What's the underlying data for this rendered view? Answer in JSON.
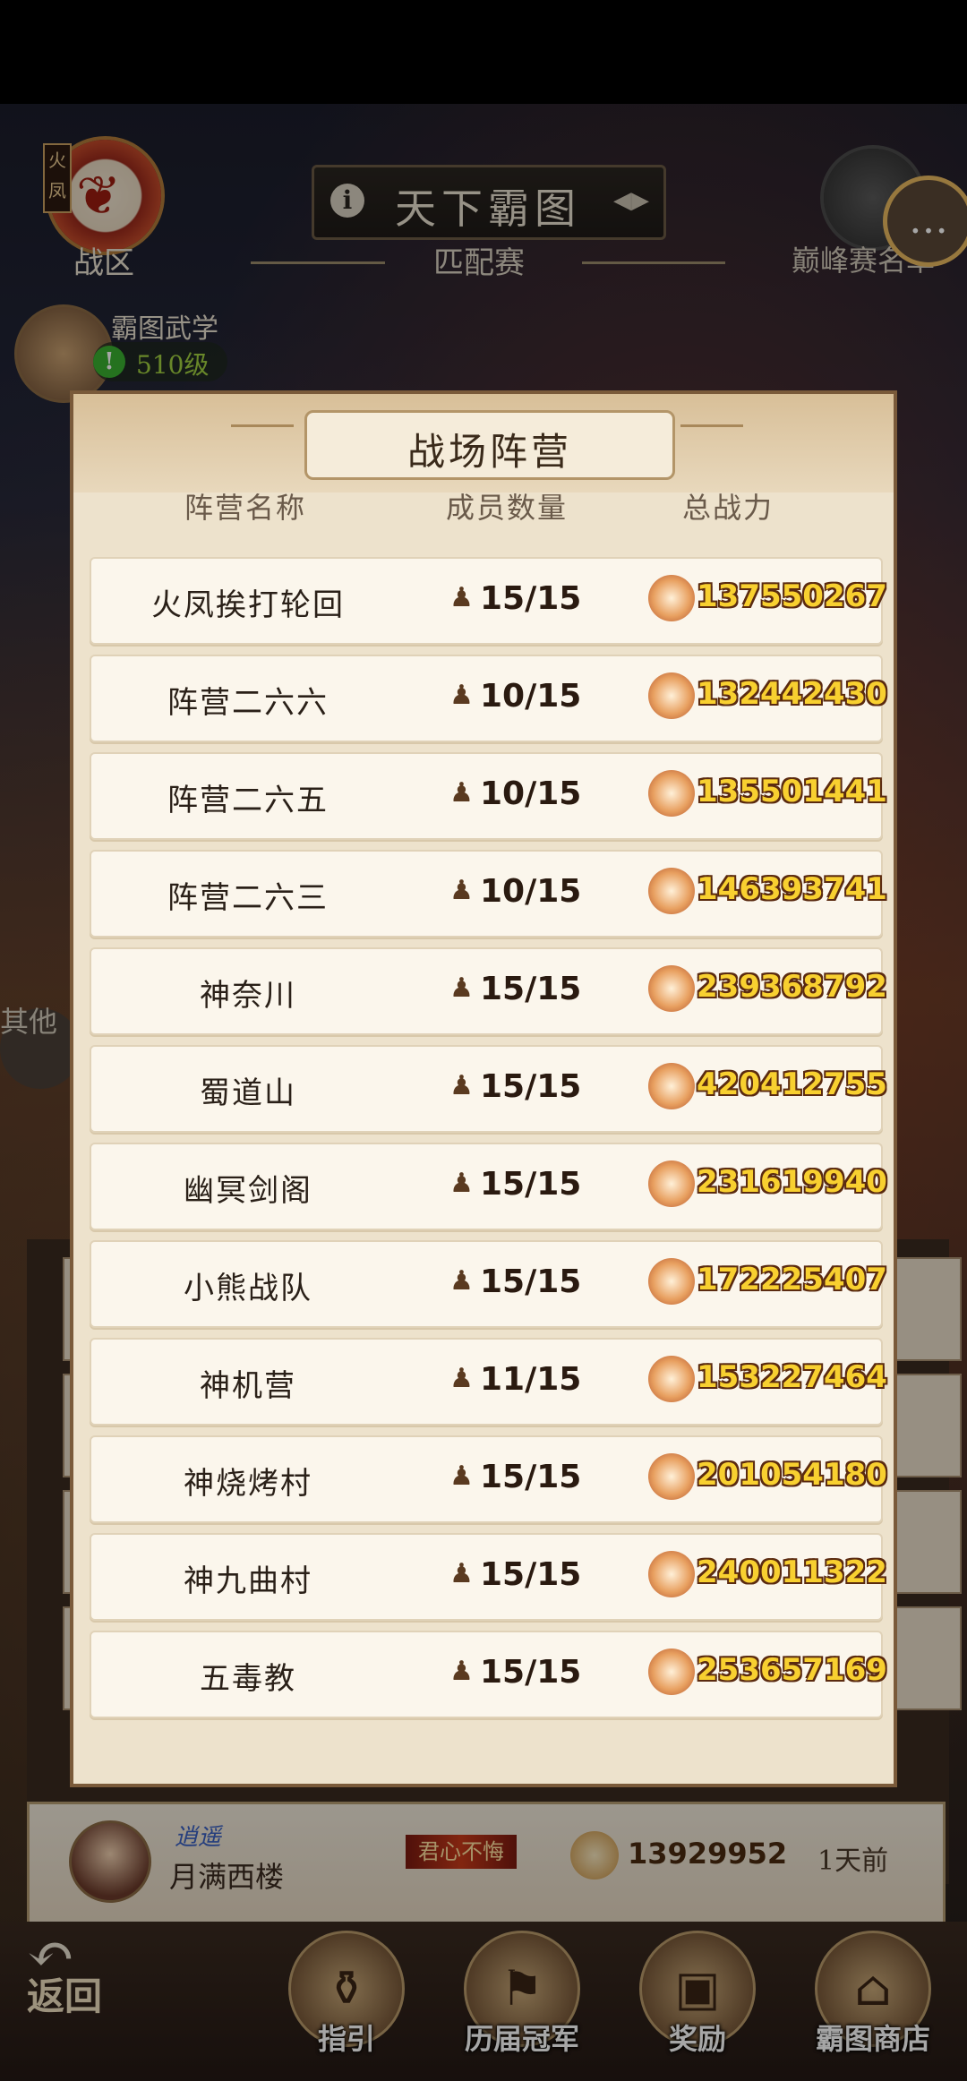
{
  "top_bar": {
    "zone_tag": "火凤",
    "zone_label": "战区",
    "title": "天下霸图",
    "match_label": "匹配赛",
    "peak_label": "巅峰赛名单",
    "martial_title": "霸图武学",
    "martial_level": "510级"
  },
  "side": {
    "other_label": "其他"
  },
  "dialog": {
    "title": "战场阵营",
    "headers": {
      "name": "阵营名称",
      "members": "成员数量",
      "power": "总战力"
    },
    "rows": [
      {
        "name": "火凤挨打轮回",
        "members": "15/15",
        "power": "137550267"
      },
      {
        "name": "阵营二六六",
        "members": "10/15",
        "power": "132442430"
      },
      {
        "name": "阵营二六五",
        "members": "10/15",
        "power": "135501441"
      },
      {
        "name": "阵营二六三",
        "members": "10/15",
        "power": "146393741"
      },
      {
        "name": "神奈川",
        "members": "15/15",
        "power": "239368792"
      },
      {
        "name": "蜀道山",
        "members": "15/15",
        "power": "420412755"
      },
      {
        "name": "幽冥剑阁",
        "members": "15/15",
        "power": "231619940"
      },
      {
        "name": "小熊战队",
        "members": "15/15",
        "power": "172225407"
      },
      {
        "name": "神机营",
        "members": "11/15",
        "power": "153227464"
      },
      {
        "name": "神烧烤村",
        "members": "15/15",
        "power": "201054180"
      },
      {
        "name": "神九曲村",
        "members": "15/15",
        "power": "240011322"
      },
      {
        "name": "五毒教",
        "members": "15/15",
        "power": "253657169"
      }
    ]
  },
  "rank_row": {
    "title": "逍遥",
    "name": "月满西楼",
    "motto": "君心不悔",
    "power": "13929952",
    "time": "1天前"
  },
  "nav": {
    "back": "返回",
    "items": [
      "指引",
      "历届冠军",
      "奖励",
      "霸图商店"
    ]
  },
  "colors": {
    "power_text": "#f8d030",
    "accent_border": "#7a5a3a"
  }
}
